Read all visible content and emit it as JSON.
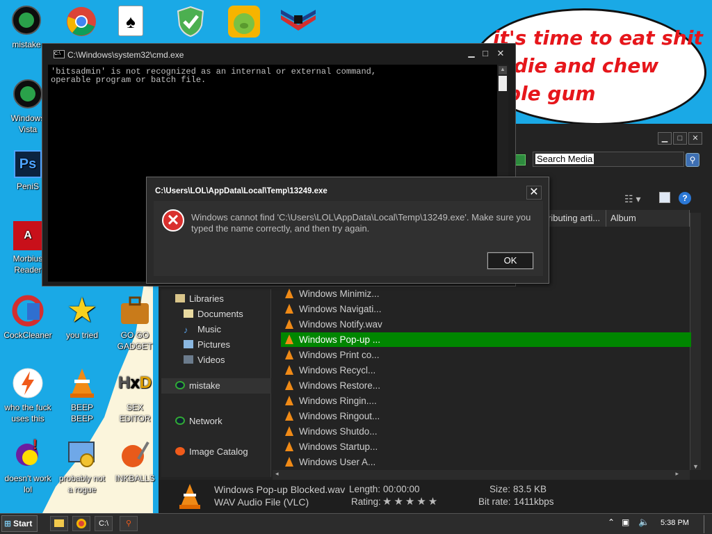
{
  "desktop": {
    "top_icons": [
      "mistake"
    ],
    "icons": [
      {
        "label": "Windows\nVista",
        "icon": "recycle-orb-icon"
      },
      {
        "label": "PeniS",
        "icon": "photoshop-icon"
      },
      {
        "label": "Morbius\nReader",
        "icon": "pdf-reader-icon"
      },
      {
        "label": "CockCleaner",
        "icon": "ccleaner-icon"
      },
      {
        "label": "you tried",
        "icon": "gold-star-icon"
      },
      {
        "label": "GO GO\nGADGET",
        "icon": "briefcase-icon"
      },
      {
        "label": "who the fuck\nuses this",
        "icon": "lightning-icon"
      },
      {
        "label": "BEEP\nBEEP",
        "icon": "vlc-cone-icon"
      },
      {
        "label": "SEX\nEDITOR",
        "icon": "hxd-icon"
      },
      {
        "label": "doesn't work\nlol",
        "icon": "yahoo-messenger-icon"
      },
      {
        "label": "probably not\na rogue",
        "icon": "gear-monitor-icon"
      },
      {
        "label": "INKBALLS",
        "icon": "inkball-icon"
      }
    ],
    "taskbar_icons": [
      "chrome-icon",
      "solitaire-icon",
      "shield-check-icon",
      "bad-piggies-icon",
      "banner-icon"
    ]
  },
  "speech_bubble": {
    "text": "it's time to eat shit\nd die and chew\nbble gum"
  },
  "cmd_window": {
    "title": "C:\\Windows\\system32\\cmd.exe",
    "output_line1": "'bitsadmin' is not recognized as an internal or external command,",
    "output_line2": "operable program or batch file."
  },
  "error_dialog": {
    "title": "C:\\Users\\LOL\\AppData\\Local\\Temp\\13249.exe",
    "message": "Windows cannot find 'C:\\Users\\LOL\\AppData\\Local\\Temp\\13249.exe'. Make sure you typed the name correctly, and then try again.",
    "ok_label": "OK"
  },
  "explorer": {
    "search_placeholder": "Search Media",
    "columns": [
      "ributing arti...",
      "Album"
    ],
    "nav": {
      "libraries": "Libraries",
      "documents": "Documents",
      "music": "Music",
      "pictures": "Pictures",
      "videos": "Videos",
      "homegroup": "mistake",
      "network": "Network",
      "image_catalog": "Image Catalog"
    },
    "files": [
      "Windows Minimiz...",
      "Windows Navigati...",
      "Windows Notify.wav",
      "Windows Pop-up ...",
      "Windows Print co...",
      "Windows Recycl...",
      "Windows Restore...",
      "Windows Ringin....",
      "Windows Ringout...",
      "Windows Shutdo...",
      "Windows Startup...",
      "Windows User A..."
    ],
    "selected_index": 3,
    "details": {
      "filename": "Windows Pop-up Blocked.wav",
      "filetype": "WAV Audio File (VLC)",
      "length_label": "Length:",
      "length_value": "00:00:00",
      "rating_label": "Rating:",
      "rating_stars": "★★★★★",
      "size_label": "Size:",
      "size_value": "83.5 KB",
      "bitrate_label": "Bit rate:",
      "bitrate_value": "1411kbps"
    }
  },
  "taskbar": {
    "start_label": "Start",
    "clock": "5:38 PM"
  },
  "colors": {
    "desktop_bg": "#1aa9e6",
    "selected_row": "#008600",
    "bubble_text": "#e6161b"
  }
}
